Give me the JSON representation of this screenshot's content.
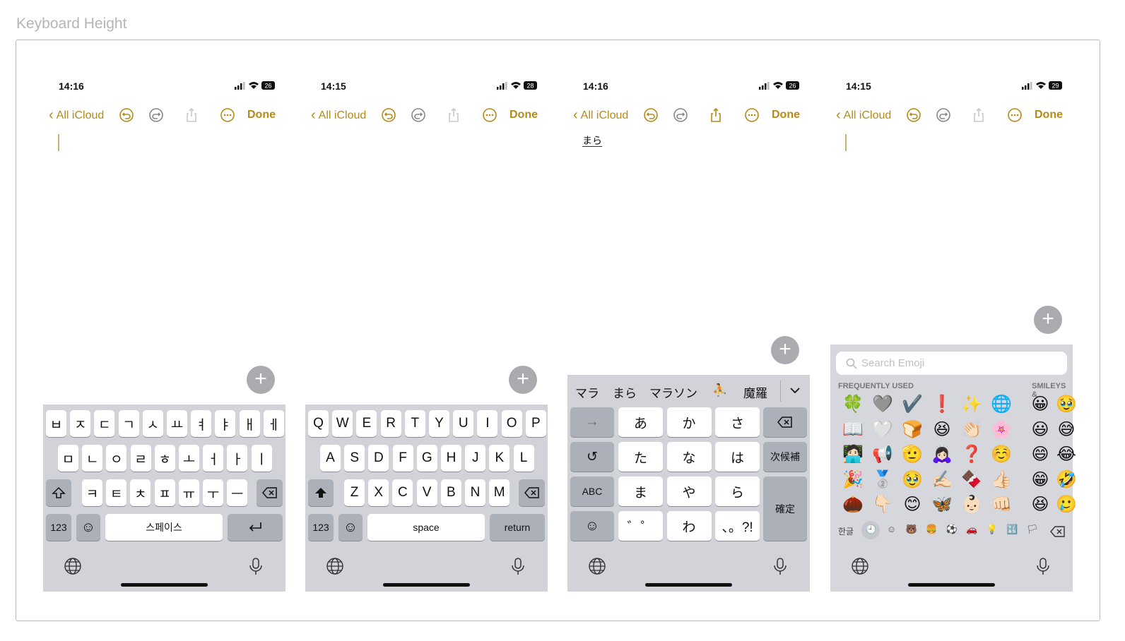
{
  "page_title": "Keyboard Height",
  "phones": [
    {
      "time": "14:16",
      "battery": "26",
      "back_label": "All iCloud",
      "done_label": "Done"
    },
    {
      "time": "14:15",
      "battery": "28",
      "back_label": "All iCloud",
      "done_label": "Done"
    },
    {
      "time": "14:16",
      "battery": "26",
      "back_label": "All iCloud",
      "done_label": "Done",
      "typed_text": "まら"
    },
    {
      "time": "14:15",
      "battery": "29",
      "back_label": "All iCloud",
      "done_label": "Done"
    }
  ],
  "plus_label": "+",
  "korean": {
    "row1": [
      "ㅂ",
      "ㅈ",
      "ㄷ",
      "ㄱ",
      "ㅅ",
      "ㅛ",
      "ㅕ",
      "ㅑ",
      "ㅐ",
      "ㅔ"
    ],
    "row2": [
      "ㅁ",
      "ㄴ",
      "ㅇ",
      "ㄹ",
      "ㅎ",
      "ㅗ",
      "ㅓ",
      "ㅏ",
      "ㅣ"
    ],
    "row3": [
      "ㅋ",
      "ㅌ",
      "ㅊ",
      "ㅍ",
      "ㅠ",
      "ㅜ",
      "ㅡ"
    ],
    "num_label": "123",
    "space_label": "스페이스"
  },
  "english": {
    "row1": [
      "Q",
      "W",
      "E",
      "R",
      "T",
      "Y",
      "U",
      "I",
      "O",
      "P"
    ],
    "row2": [
      "A",
      "S",
      "D",
      "F",
      "G",
      "H",
      "J",
      "K",
      "L"
    ],
    "row3": [
      "Z",
      "X",
      "C",
      "V",
      "B",
      "N",
      "M"
    ],
    "num_label": "123",
    "space_label": "space",
    "return_label": "return"
  },
  "japanese": {
    "candidates": [
      "マラ",
      "まら",
      "マラソン",
      "⛹️",
      "魔羅"
    ],
    "keys": [
      "あ",
      "か",
      "さ",
      "た",
      "な",
      "は",
      "ま",
      "や",
      "ら",
      "゛゜",
      "わ",
      "、。?!"
    ],
    "arrow_label": "→",
    "undo_label": "↺",
    "next_label": "次候補",
    "abc_label": "ABC",
    "confirm_label": "確定"
  },
  "emoji": {
    "search_placeholder": "Search Emoji",
    "frequently_used_label": "FREQUENTLY USED",
    "smileys_label": "SMILEYS &",
    "frequent": [
      "🍀",
      "📖",
      "🧑🏻‍💻",
      "🎉",
      "🌰",
      "🩶",
      "🤍",
      "📢",
      "🥈",
      "👇🏻",
      "✔️",
      "🍞",
      "🫡",
      "🥹",
      "😊",
      "❗",
      "😆",
      "🙇🏻‍♀️",
      "✍🏻",
      "🦋",
      "✨",
      "👏🏻",
      "❓",
      "🍫",
      "👶🏻",
      "🌐",
      "🌸",
      "☺️",
      "👍🏻",
      "👊🏻"
    ],
    "smileys": [
      "😀",
      "😃",
      "😄",
      "😁",
      "😆"
    ],
    "smileys_partial": [
      "🥹",
      "😅",
      "😂",
      "🤣",
      "🥲"
    ],
    "korean_label": "한글",
    "category_icons": [
      "🕘",
      "☺",
      "🐻",
      "🍔",
      "⚽",
      "🚗",
      "💡",
      "🔣",
      "🏳"
    ]
  }
}
